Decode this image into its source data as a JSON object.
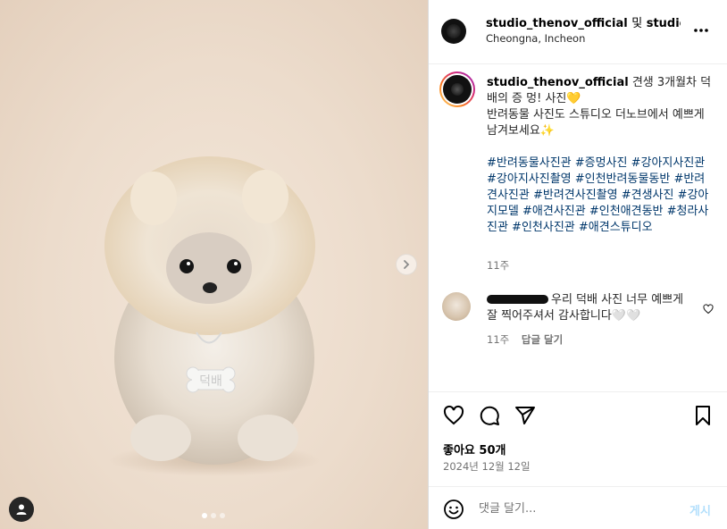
{
  "post": {
    "header": {
      "account": "studio_thenov_official",
      "conjunction": "및",
      "collaborator": "studio_th",
      "location": "Cheongna, Incheon"
    },
    "image": {
      "tag_text": "덕배",
      "carousel": {
        "current": 1,
        "total": 3
      }
    },
    "caption": {
      "username": "studio_thenov_official",
      "text_line1": "견생 3개월차 덕배의 증 멍! 사진💛",
      "text_line2": "반려동물 사진도 스튜디오 더노브에서 예쁘게 남겨보세요✨",
      "hashtags": "#반려동물사진관 #증멍사진 #강아지사진관 #강아지사진촬영 #인천반려동물동반 #반려견사진관 #반려견사진촬영 #견생사진 #강아지모델 #애견사진관 #인천애견동반 #청라사진관 #인천사진관 #애견스튜디오",
      "time": "11주"
    },
    "comment": {
      "text": "우리 덕배 사진 너무 예쁘게 잘 찍어주셔서 감사합니다🤍🤍",
      "time": "11주",
      "reply_label": "답글 달기"
    },
    "likes": "좋아요 50개",
    "date": "2024년 12월 12일",
    "input": {
      "placeholder": "댓글 달기...",
      "post_label": "게시"
    },
    "icons": {
      "more": "more-horizontal-icon",
      "like": "heart-icon",
      "comment": "comment-icon",
      "share": "send-icon",
      "save": "bookmark-icon",
      "emoji": "emoji-icon",
      "next": "chevron-right-icon",
      "user_tag": "user-icon"
    },
    "colors": {
      "hashtag": "#00376b",
      "post_button": "#b2dffc",
      "muted": "#737373"
    }
  }
}
